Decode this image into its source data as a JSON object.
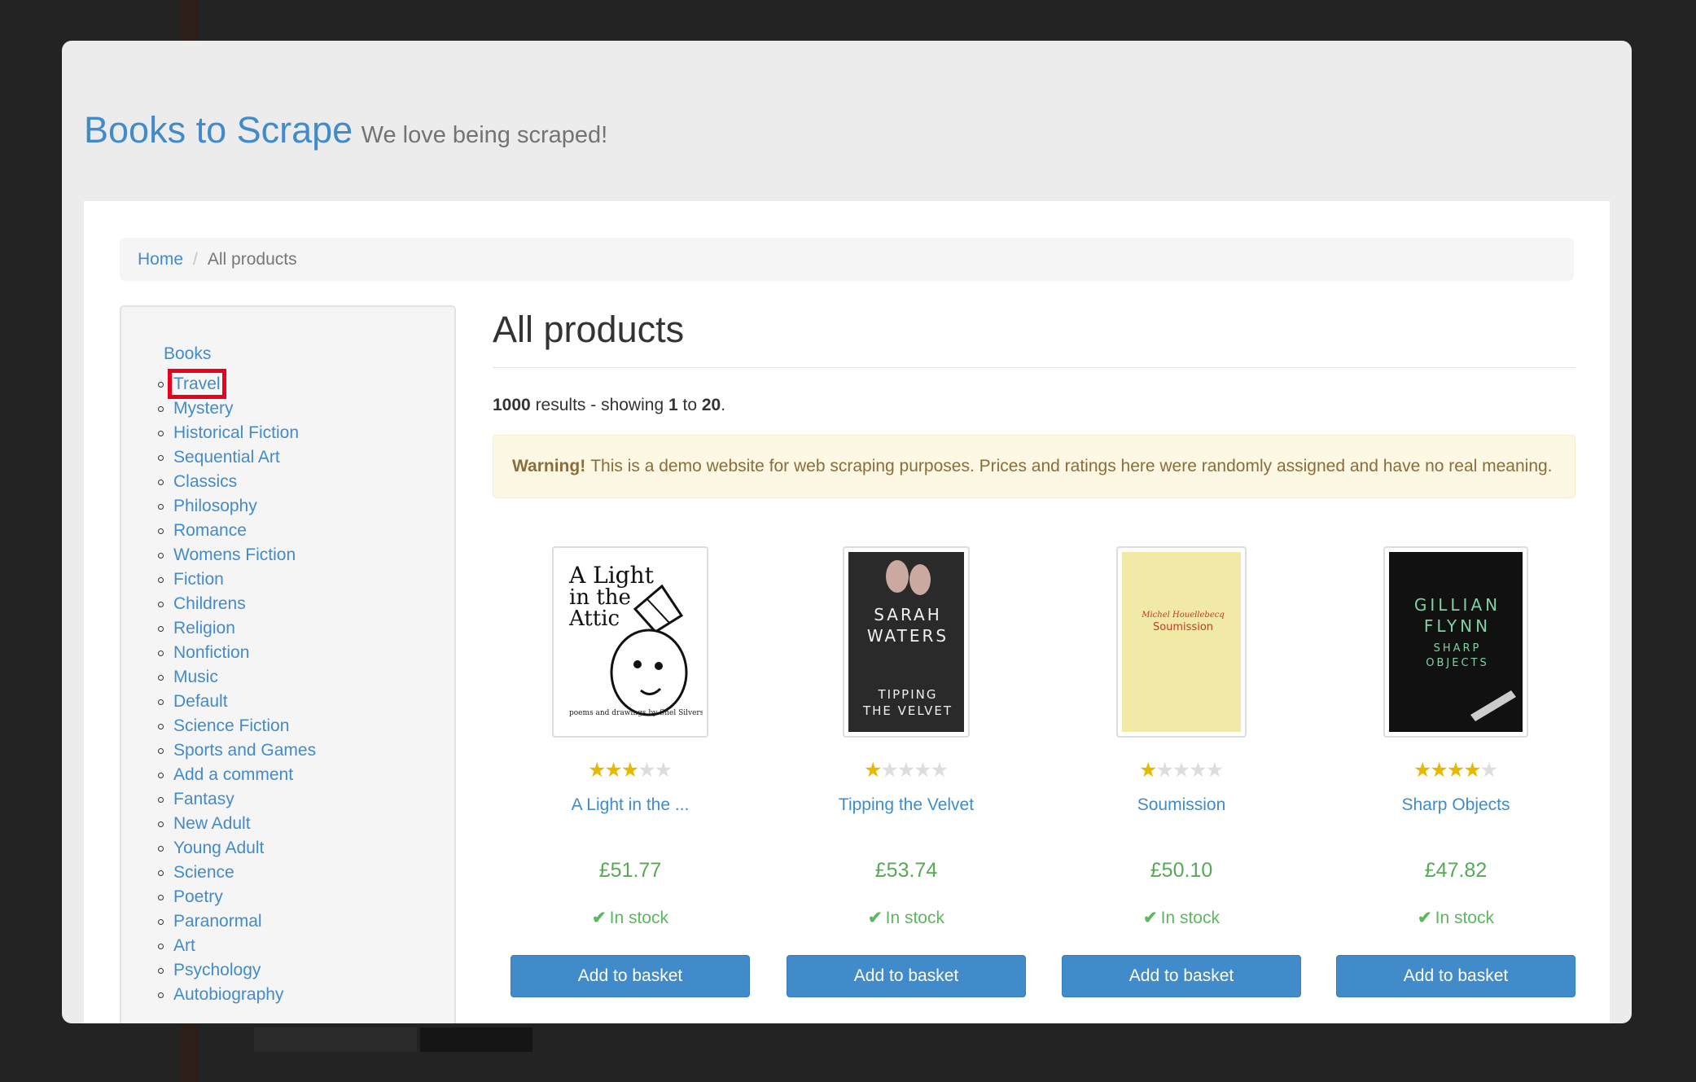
{
  "header": {
    "brand": "Books to Scrape",
    "tagline": "We love being scraped!"
  },
  "breadcrumb": {
    "home": "Home",
    "current": "All products"
  },
  "sidebar": {
    "books_label": "Books",
    "categories": [
      "Travel",
      "Mystery",
      "Historical Fiction",
      "Sequential Art",
      "Classics",
      "Philosophy",
      "Romance",
      "Womens Fiction",
      "Fiction",
      "Childrens",
      "Religion",
      "Nonfiction",
      "Music",
      "Default",
      "Science Fiction",
      "Sports and Games",
      "Add a comment",
      "Fantasy",
      "New Adult",
      "Young Adult",
      "Science",
      "Poetry",
      "Paranormal",
      "Art",
      "Psychology",
      "Autobiography"
    ]
  },
  "main": {
    "title": "All products",
    "results": {
      "total": "1000",
      "text_mid": "results - showing",
      "from": "1",
      "to_word": "to",
      "to": "20"
    },
    "alert": {
      "strong": "Warning!",
      "text": "This is a demo website for web scraping purposes. Prices and ratings here were randomly assigned and have no real meaning."
    }
  },
  "products": [
    {
      "title": "A Light in the ...",
      "price": "£51.77",
      "rating": 3,
      "stock": "In stock",
      "button": "Add to basket",
      "cover": {
        "lines": [
          "A Light",
          "in the",
          "Attic"
        ],
        "footer": "poems and drawings by Shel Silverstein"
      }
    },
    {
      "title": "Tipping the Velvet",
      "price": "£53.74",
      "rating": 1,
      "stock": "In stock",
      "button": "Add to basket",
      "cover": {
        "lines": [
          "SARAH",
          "WATERS",
          "TIPPING",
          "THE VELVET"
        ]
      }
    },
    {
      "title": "Soumission",
      "price": "£50.10",
      "rating": 1,
      "stock": "In stock",
      "button": "Add to basket",
      "cover": {
        "lines": [
          "Michel Houellebecq",
          "Soumission"
        ]
      }
    },
    {
      "title": "Sharp Objects",
      "price": "£47.82",
      "rating": 4,
      "stock": "In stock",
      "button": "Add to basket",
      "cover": {
        "lines": [
          "GILLIAN",
          "FLYNN",
          "SHARP",
          "OBJECTS"
        ]
      }
    }
  ],
  "colors": {
    "link": "#428bca",
    "price": "#57a957",
    "button": "#428bca",
    "highlight": "#e8001c"
  }
}
